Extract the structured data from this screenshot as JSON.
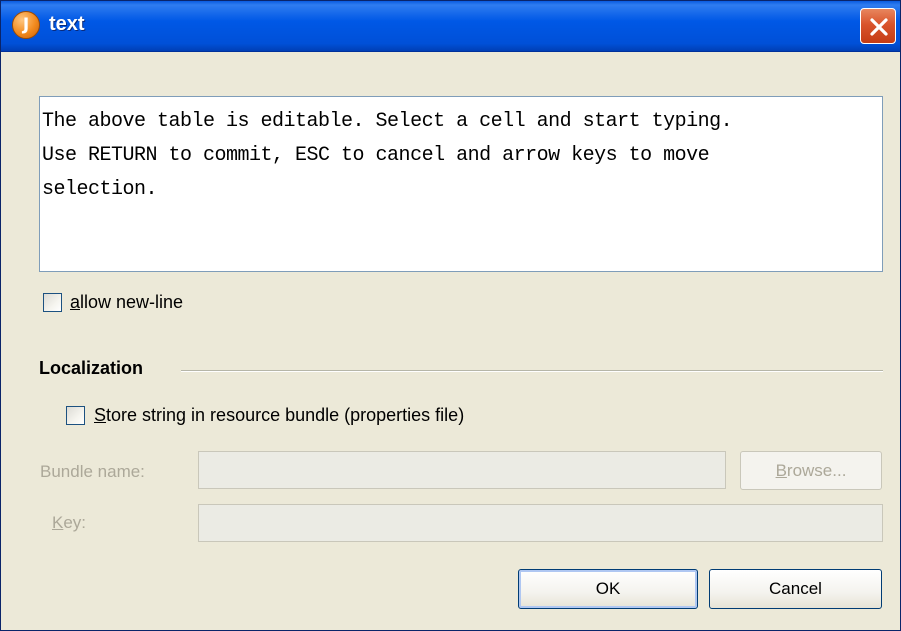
{
  "window": {
    "title": "text",
    "app_icon_letter": "J",
    "close_icon": "close-x-icon"
  },
  "text_area": {
    "lines": [
      "The above table is editable. Select a cell and start typing.",
      "Use RETURN to commit, ESC to cancel and arrow keys to move",
      "selection."
    ]
  },
  "allow_newline": {
    "mnemonic": "a",
    "label_rest": "llow new-line",
    "checked": false
  },
  "localization": {
    "section_label": "Localization",
    "store_checkbox": {
      "mnemonic": "S",
      "label_rest": "tore string in resource bundle (properties file)",
      "checked": false
    },
    "bundle_name": {
      "label": "Bundle name:",
      "value": ""
    },
    "browse_button": {
      "mnemonic": "B",
      "label_rest": "rowse..."
    },
    "key": {
      "mnemonic": "K",
      "label_rest": "ey:",
      "value": ""
    }
  },
  "buttons": {
    "ok": "OK",
    "cancel": "Cancel"
  },
  "colors": {
    "titlebar": "#0058E6",
    "dialog_bg": "#ECE9D8",
    "close_button": "#D9542C",
    "disabled_text": "#ACA899"
  }
}
